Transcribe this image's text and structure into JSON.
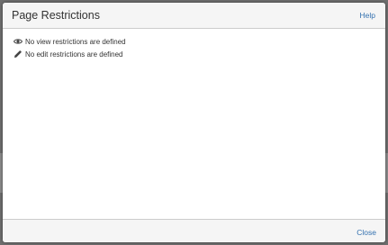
{
  "dialog": {
    "title": "Page Restrictions",
    "help_label": "Help",
    "close_label": "Close"
  },
  "restrictions": {
    "view": {
      "icon": "eye-icon",
      "text": "No view restrictions are defined"
    },
    "edit": {
      "icon": "pencil-icon",
      "text": "No edit restrictions are defined"
    }
  },
  "colors": {
    "link": "#3572b0",
    "text": "#333333",
    "header_bg": "#f5f5f5",
    "backdrop": "#6e6e6e"
  }
}
